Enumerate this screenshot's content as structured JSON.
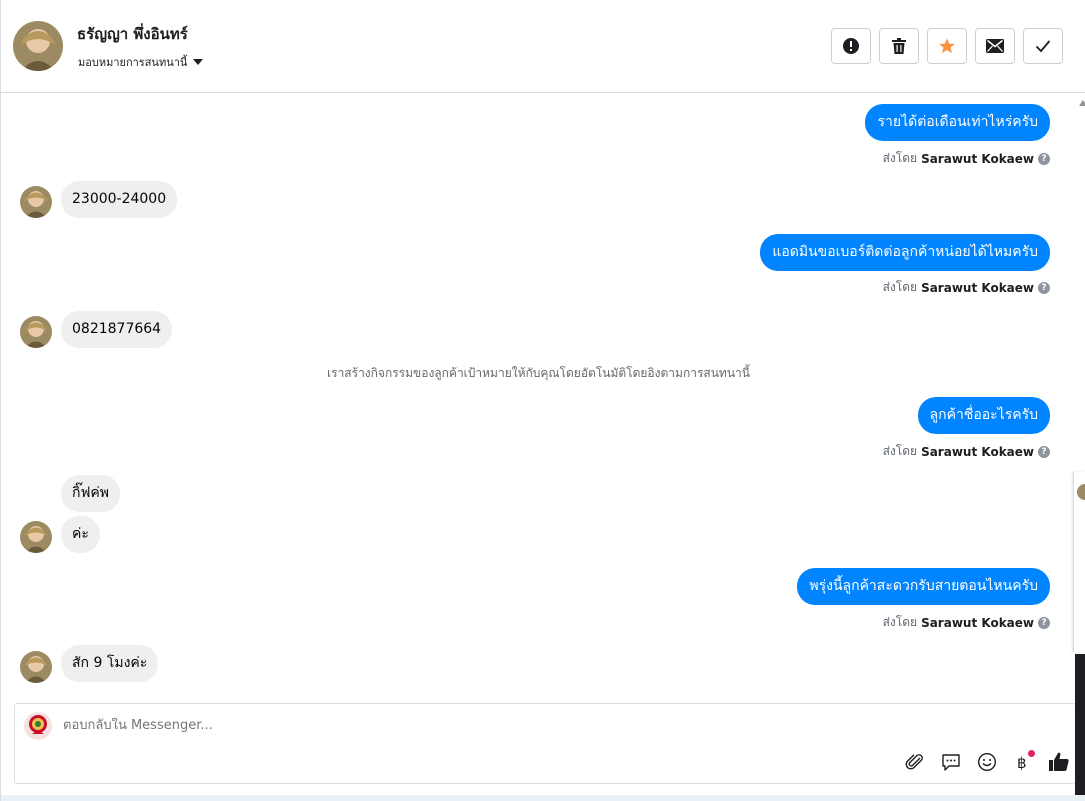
{
  "header": {
    "contact_name": "ธรัญญา พึ่งอินทร์",
    "assign_label": "มอบหมายการสนทนานี้",
    "actions": [
      {
        "name": "mark-spam-button",
        "icon": "alert-icon"
      },
      {
        "name": "delete-button",
        "icon": "trash-icon"
      },
      {
        "name": "star-button",
        "icon": "star-icon"
      },
      {
        "name": "mark-unread-button",
        "icon": "envelope-icon"
      },
      {
        "name": "mark-done-button",
        "icon": "check-icon"
      }
    ]
  },
  "messages": [
    {
      "dir": "out",
      "text": "รายได้ต่อเดือนเท่าไหร่ครับ",
      "sent_by_prefix": "ส่งโดย",
      "sent_by": "Sarawut Kokaew"
    },
    {
      "dir": "in",
      "text": "23000-24000"
    },
    {
      "dir": "out",
      "text": "แอดมินขอเบอร์ติดต่อลูกค้าหน่อยได้ไหมครับ",
      "sent_by_prefix": "ส่งโดย",
      "sent_by": "Sarawut Kokaew"
    },
    {
      "dir": "in",
      "text": "0821877664"
    },
    {
      "dir": "system",
      "text": "เราสร้างกิจกรรมของลูกค้าเป้าหมายให้กับคุณโดยอัตโนมัติโดยอิงตามการสนทนานี้"
    },
    {
      "dir": "out",
      "text": "ลูกค้าชื่ออะไรครับ",
      "sent_by_prefix": "ส่งโดย",
      "sent_by": "Sarawut Kokaew"
    },
    {
      "dir": "in",
      "text": "กิ๊ฟค่พ"
    },
    {
      "dir": "in",
      "text": "ค่ะ"
    },
    {
      "dir": "out",
      "text": "พรุ่งนี้ลูกค้าสะดวกรับสายตอนไหนครับ",
      "sent_by_prefix": "ส่งโดย",
      "sent_by": "Sarawut Kokaew"
    },
    {
      "dir": "in",
      "text": "สัก 9 โมงค่ะ"
    }
  ],
  "composer": {
    "placeholder": "ตอบกลับใน Messenger...",
    "tools": [
      "paperclip-icon",
      "chat-bubble-icon",
      "emoji-icon",
      "baht-icon",
      "thumbs-up-icon"
    ]
  },
  "colors": {
    "outgoing_bubble": "#0084ff",
    "incoming_bubble": "#eeeff1",
    "star": "#f7923b"
  }
}
